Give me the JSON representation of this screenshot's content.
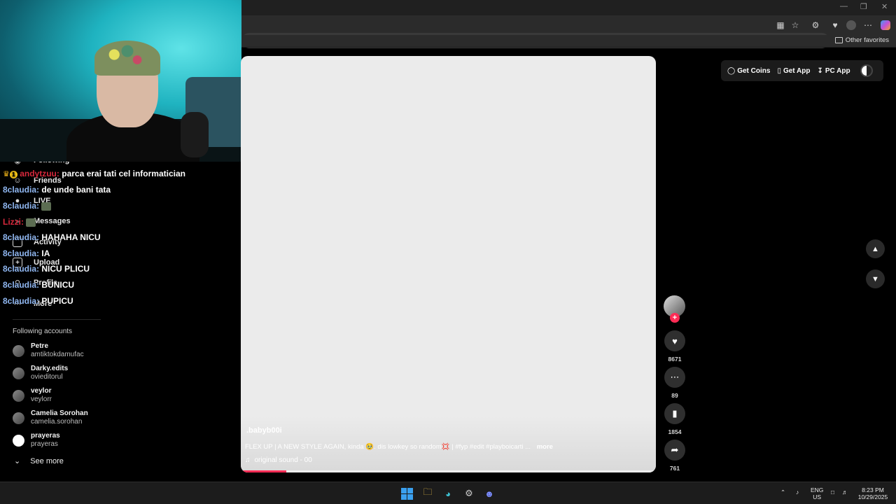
{
  "browser": {
    "other_favorites": "Other favorites"
  },
  "sidebar": {
    "nav": [
      {
        "label": "Following",
        "icon": "following-icon"
      },
      {
        "label": "Friends",
        "icon": "friends-icon"
      },
      {
        "label": "LIVE",
        "icon": "live-icon"
      },
      {
        "label": "Messages",
        "icon": "messages-icon"
      },
      {
        "label": "Activity",
        "icon": "activity-icon"
      },
      {
        "label": "Upload",
        "icon": "upload-icon"
      },
      {
        "label": "Profile",
        "icon": "profile-icon"
      },
      {
        "label": "More",
        "icon": "more-icon"
      }
    ],
    "following_title": "Following accounts",
    "accounts": [
      {
        "name": "Petre",
        "user": "amtiktokdamufac"
      },
      {
        "name": "Darky.edits",
        "user": "ovieditorul"
      },
      {
        "name": "veylor",
        "user": "veylorr"
      },
      {
        "name": "Camelia Sorohan",
        "user": "camelia.sorohan"
      },
      {
        "name": "prayeras",
        "user": "prayeras"
      }
    ],
    "see_more": "See more"
  },
  "chat": [
    {
      "user": "andytzuu:",
      "msg": "parca erai tati cel informatician",
      "user_color": "red",
      "badges": true
    },
    {
      "user": "8claudia:",
      "msg": "de unde bani tata",
      "user_color": "blue"
    },
    {
      "user": "8claudia:",
      "msg": "",
      "user_color": "blue",
      "emote": true
    },
    {
      "user": "Lizzi:",
      "msg": "",
      "user_color": "red",
      "emote": true
    },
    {
      "user": "8claudia:",
      "msg": "HAHAHA NICU",
      "user_color": "blue"
    },
    {
      "user": "8claudia:",
      "msg": "IA",
      "user_color": "blue"
    },
    {
      "user": "8claudia:",
      "msg": "NICU PLICU",
      "user_color": "blue"
    },
    {
      "user": "8claudia:",
      "msg": "BUNICU",
      "user_color": "blue"
    },
    {
      "user": "8claudia:",
      "msg": "PUPICU",
      "user_color": "blue"
    }
  ],
  "video": {
    "author": ".babyb00i",
    "caption": "FLEX UP | A NEW STYLE AGAIN, kinda 🥹. dis lowkey so random💢 | #fyp #edit #playboicarti ...",
    "more": "more",
    "sound": "original sound - 00",
    "progress_fraction": 0.11
  },
  "actions": {
    "likes": "8671",
    "comments": "89",
    "saves": "1854",
    "shares": "761"
  },
  "top_buttons": {
    "coins": "Get Coins",
    "app": "Get App",
    "pc_app": "PC App"
  },
  "tray": {
    "lang": "ENG",
    "region": "US",
    "time": "8:23 PM",
    "date": "10/29/2025"
  },
  "colors": {
    "accent": "#fe2c55",
    "chat_user_blue": "#8fb6f0",
    "chat_user_red": "#d8283c",
    "webcam_bg": "#1fb3c0"
  }
}
